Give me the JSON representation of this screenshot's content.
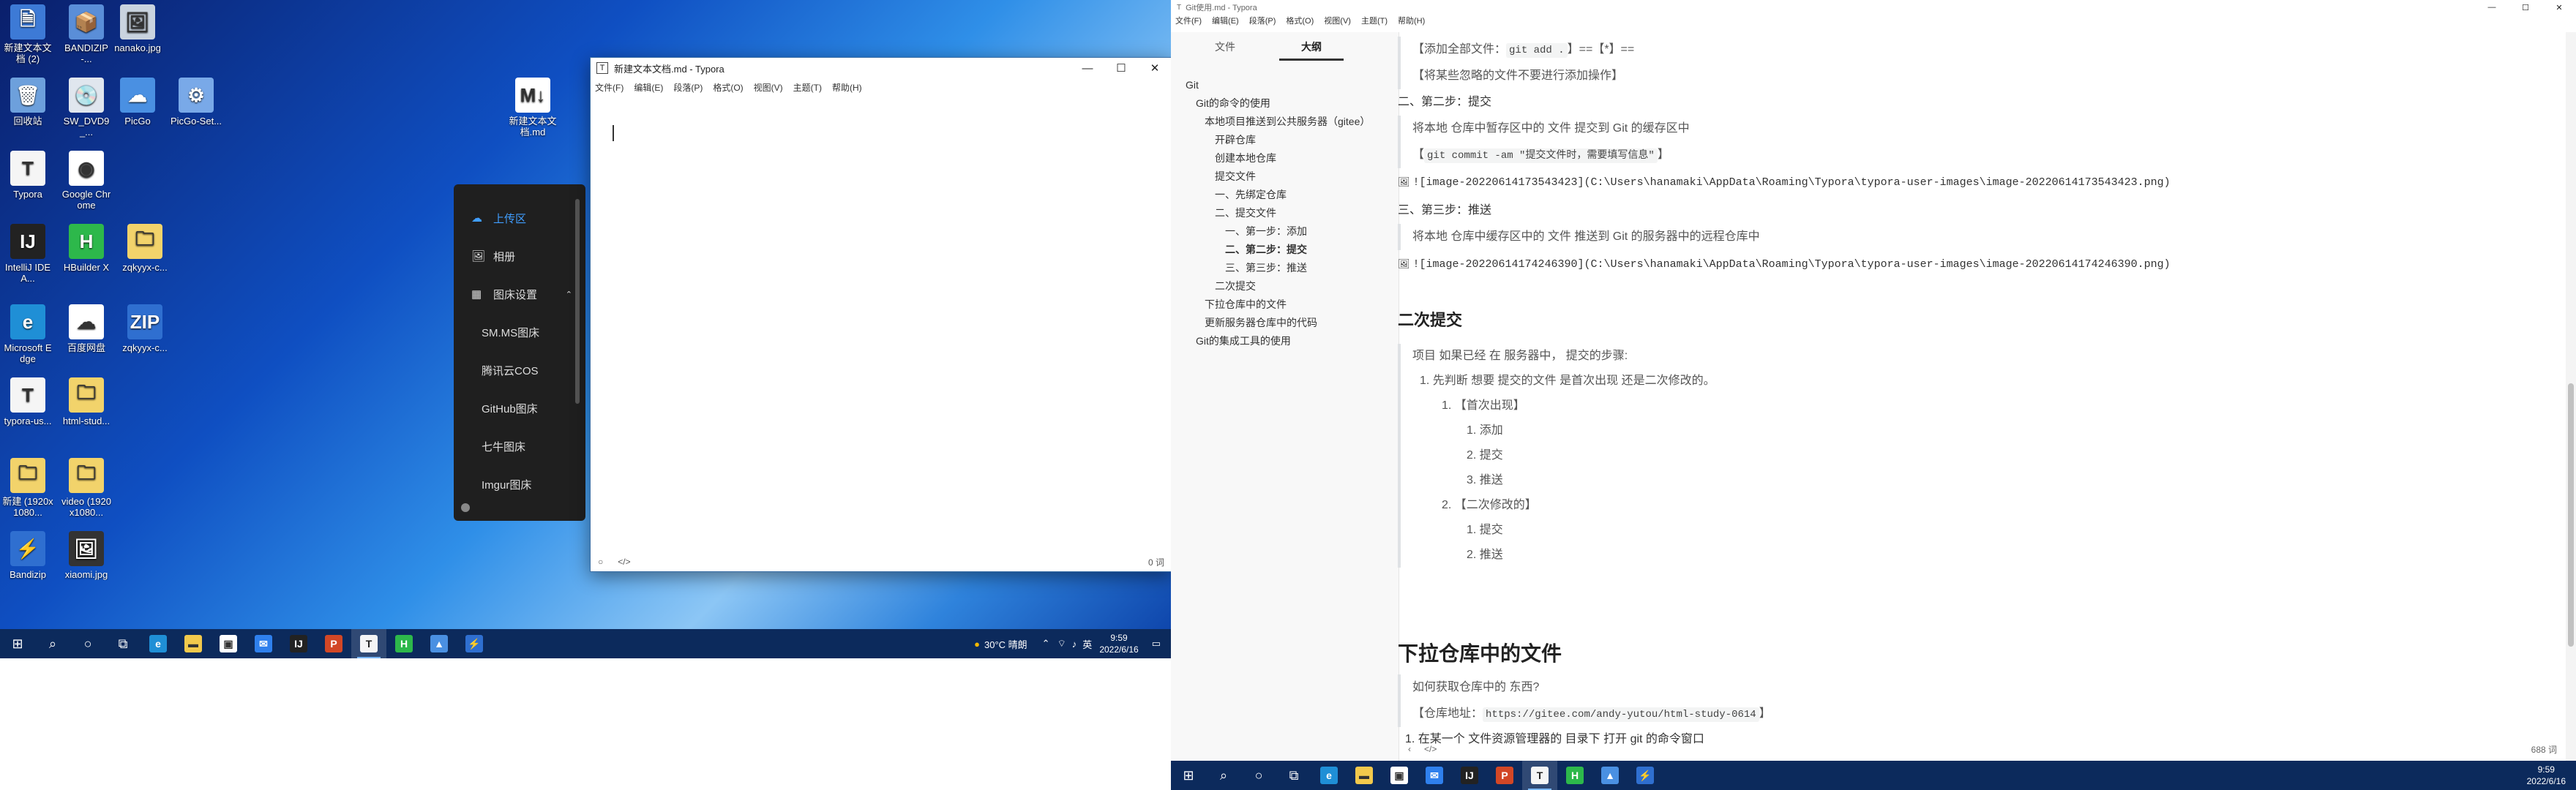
{
  "desktop": {
    "icons": [
      {
        "label": "新建文本文档 (2)",
        "glyph": "🗎",
        "bg": "#3d7ad6"
      },
      {
        "label": "BANDIZIP-...",
        "glyph": "📦",
        "bg": "#5a8ed8"
      },
      {
        "label": "nanako.jpg",
        "glyph": "🖼",
        "bg": "#c9d3df"
      },
      {
        "label": "回收站",
        "glyph": "🗑",
        "bg": "#6da0dc"
      },
      {
        "label": "SW_DVD9_...",
        "glyph": "💿",
        "bg": "#e0e6ee"
      },
      {
        "label": "PicGo",
        "glyph": "☁",
        "bg": "#4a90e2"
      },
      {
        "label": "PicGo-Set...",
        "glyph": "⚙",
        "bg": "#79a9e8"
      },
      {
        "label": "Typora",
        "glyph": "T",
        "bg": "#f5f5f5"
      },
      {
        "label": "Google Chrome",
        "glyph": "◉",
        "bg": "#ffffff"
      },
      {
        "label": "IntelliJ IDEA...",
        "glyph": "IJ",
        "bg": "#222222"
      },
      {
        "label": "HBuilder X",
        "glyph": "H",
        "bg": "#2db84b"
      },
      {
        "label": "zqkyyx-c...",
        "glyph": "🗀",
        "bg": "#f2d36b"
      },
      {
        "label": "Microsoft Edge",
        "glyph": "e",
        "bg": "#1f8fd6"
      },
      {
        "label": "百度网盘",
        "glyph": "☁",
        "bg": "#ffffff"
      },
      {
        "label": "zqkyyx-c...",
        "glyph": "ZIP",
        "bg": "#2f6fd0"
      },
      {
        "label": "typora-us...",
        "glyph": "T",
        "bg": "#f5f5f5"
      },
      {
        "label": "html-stud...",
        "glyph": "🗀",
        "bg": "#f2d36b"
      },
      {
        "label": "新建 (1920x1080...",
        "glyph": "🗀",
        "bg": "#f2d36b"
      },
      {
        "label": "video (1920x1080...",
        "glyph": "🗀",
        "bg": "#f2d36b"
      },
      {
        "label": "Bandizip",
        "glyph": "⚡",
        "bg": "#2f6fd0"
      },
      {
        "label": "xiaomi.jpg",
        "glyph": "🖼",
        "bg": "#333333"
      },
      {
        "label": "新建文本文档.md",
        "glyph": "M↓",
        "bg": "#ffffff"
      }
    ]
  },
  "typora_small": {
    "title": "新建文本文档.md - Typora",
    "menu": [
      "文件(F)",
      "编辑(E)",
      "段落(P)",
      "格式(O)",
      "视图(V)",
      "主题(T)",
      "帮助(H)"
    ],
    "status_words": "0 词",
    "status_code": "</>"
  },
  "picgo_menu": {
    "items": [
      {
        "icon": "☁",
        "label": "上传区",
        "active": true
      },
      {
        "icon": "🖼",
        "label": "相册",
        "active": false
      },
      {
        "icon": "▦",
        "label": "图床设置",
        "active": false
      }
    ],
    "sub_items": [
      "SM.MS图床",
      "腾讯云COS",
      "GitHub图床",
      "七牛图床",
      "Imgur图床"
    ]
  },
  "taskbar1": {
    "weather": "30°C 晴朗",
    "ime": "英",
    "time": "9:59",
    "date": "2022/6/16"
  },
  "typora_big": {
    "title": "Git使用.md - Typora",
    "menu": [
      "文件(F)",
      "编辑(E)",
      "段落(P)",
      "格式(O)",
      "视图(V)",
      "主题(T)",
      "帮助(H)"
    ],
    "tabs": [
      "文件",
      "大纲"
    ],
    "outline": [
      {
        "text": "Git",
        "level": 0
      },
      {
        "text": "Git的命令的使用",
        "level": 1
      },
      {
        "text": "本地项目推送到公共服务器（gitee）",
        "level": 2
      },
      {
        "text": "（gitee）",
        "level": 3
      },
      {
        "text": "开辟仓库",
        "level": 3
      },
      {
        "text": "创建本地仓库",
        "level": 3
      },
      {
        "text": "提交文件",
        "level": 3
      },
      {
        "text": "一、先绑定仓库",
        "level": 4
      },
      {
        "text": "二、提交文件",
        "level": 4
      },
      {
        "text": "一、第一步：添加",
        "level": 5
      },
      {
        "text": "二、第二步：提交",
        "level": 5
      },
      {
        "text": "三、第三步：推送",
        "level": 5
      },
      {
        "text": "二次提交",
        "level": 3
      },
      {
        "text": "下拉仓库中的文件",
        "level": 2
      },
      {
        "text": "更新服务器仓库中的代码",
        "level": 2
      },
      {
        "text": "Git的集成工具的使用",
        "level": 1
      }
    ],
    "doc": {
      "bq1_prefix": "【添加全部文件：",
      "bq1_code": "git add .",
      "bq1_suffix": "】==【*】==",
      "bq2": "【将某些忽略的文件不要进行添加操作】",
      "h_commit": "二、第二步：提交",
      "bq3": "将本地 仓库中暂存区中的 文件 提交到 Git 的缓存区中",
      "bq4_prefix": "【",
      "bq4_code": "git commit -am \"提交文件时，需要填写信息\"",
      "bq4_suffix": "】",
      "img1": "![image-20220614173543423](C:\\Users\\hanamaki\\AppData\\Roaming\\Typora\\typora-user-images\\image-20220614173543423.png)",
      "h_push": "三、第三步：推送",
      "bq5": "将本地 仓库中缓存区中的 文件 推送到 Git 的服务器中的远程仓库中",
      "img2": "![image-20220614174246390](C:\\Users\\hanamaki\\AppData\\Roaming\\Typora\\typora-user-images\\image-20220614174246390.png)",
      "h2_second": "二次提交",
      "bq6": "项目 如果已经 在 服务器中， 提交的步骤:",
      "li1": "1. 先判断 想要 提交的文件 是首次出现 还是二次修改的。",
      "li1a": "1. 【首次出现】",
      "li1a1": "1. 添加",
      "li1a2": "2. 提交",
      "li1a3": "3. 推送",
      "li1b": "2. 【二次修改的】",
      "li1b1": "1. 提交",
      "li1b2": "2. 推送",
      "h1_pull": "下拉仓库中的文件",
      "bq7": "如何获取仓库中的 东西?",
      "bq8_prefix": "【仓库地址：",
      "bq8_code": "https://gitee.com/andy-yutou/html-study-0614",
      "bq8_suffix": "】",
      "li2": "1. 在某一个 文件资源管理器的 目录下 打开 git 的命令窗口"
    },
    "status_words": "688 词",
    "status_code": "</>"
  },
  "taskbar2": {
    "time": "9:59",
    "date": "2022/6/16"
  }
}
